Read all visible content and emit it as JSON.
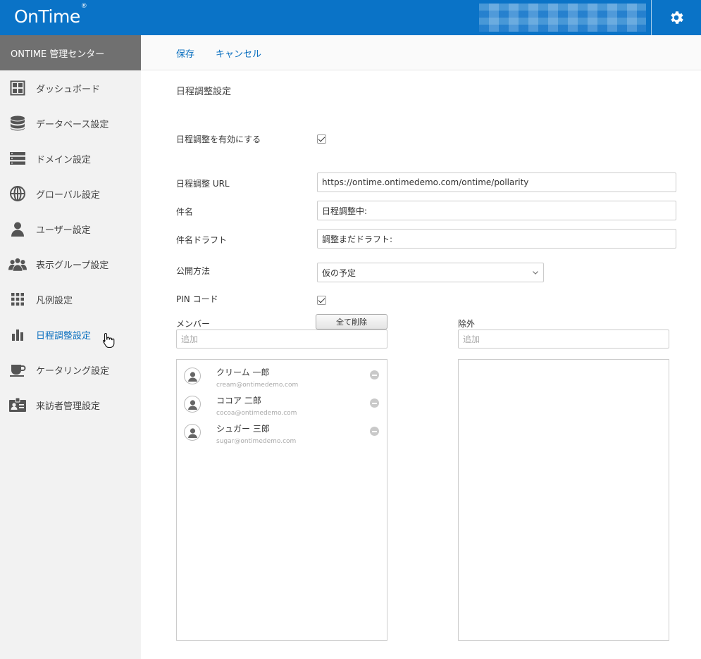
{
  "header": {
    "logo": "OnTime",
    "logo_mark": "®",
    "settings_icon": "gear-icon"
  },
  "sidebar": {
    "title": "ONTIME 管理センター",
    "items": [
      {
        "label": "ダッシュボード",
        "icon": "dashboard-icon"
      },
      {
        "label": "データベース設定",
        "icon": "database-icon"
      },
      {
        "label": "ドメイン設定",
        "icon": "server-icon"
      },
      {
        "label": "グローバル設定",
        "icon": "globe-icon"
      },
      {
        "label": "ユーザー設定",
        "icon": "user-icon"
      },
      {
        "label": "表示グループ設定",
        "icon": "group-icon"
      },
      {
        "label": "凡例設定",
        "icon": "grid-icon"
      },
      {
        "label": "日程調整設定",
        "icon": "bar-chart-icon"
      },
      {
        "label": "ケータリング設定",
        "icon": "cup-icon"
      },
      {
        "label": "来訪者管理設定",
        "icon": "id-card-icon"
      }
    ],
    "active": "日程調整設定"
  },
  "toolbar": {
    "save": "保存",
    "cancel": "キャンセル"
  },
  "form": {
    "section_title": "日程調整設定",
    "enable_label": "日程調整を有効にする",
    "enable_checked": true,
    "url_label": "日程調整 URL",
    "url_value": "https://ontime.ontimedemo.com/ontime/pollarity",
    "subject_label": "件名",
    "subject_value": "日程調整中:",
    "draft_label": "件名ドラフト",
    "draft_value": "調整まだドラフト:",
    "publish_label": "公開方法",
    "publish_value": "仮の予定",
    "pin_label": "PIN コード",
    "pin_checked": true
  },
  "members": {
    "label": "メンバー",
    "clear_all": "全て削除",
    "add_placeholder": "追加",
    "list": [
      {
        "name": "クリーム 一郎",
        "email": "cream@ontimedemo.com"
      },
      {
        "name": "ココア 二郎",
        "email": "cocoa@ontimedemo.com"
      },
      {
        "name": "シュガー 三郎",
        "email": "sugar@ontimedemo.com"
      }
    ]
  },
  "exclude": {
    "label": "除外",
    "add_placeholder": "追加"
  }
}
